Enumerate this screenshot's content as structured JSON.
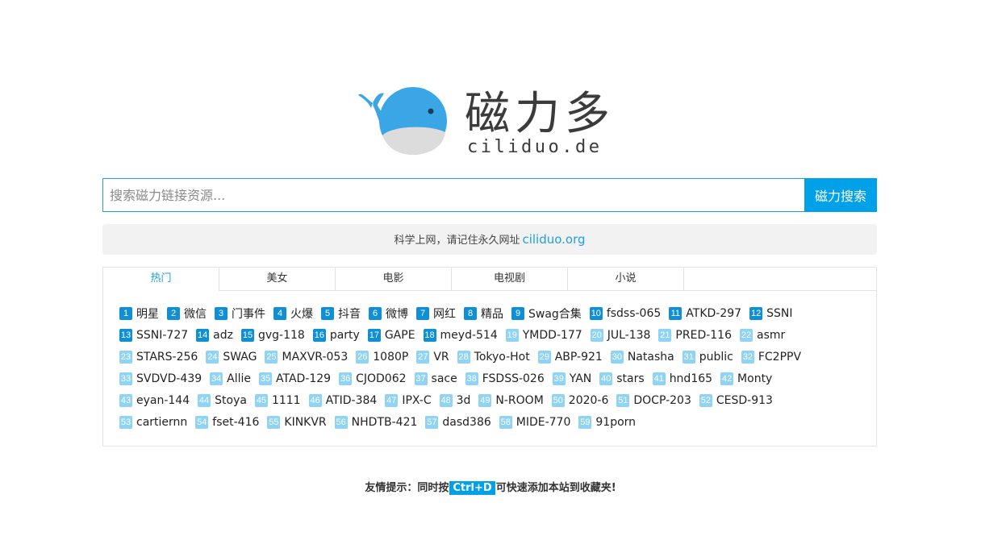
{
  "logo": {
    "title": "磁力多",
    "domain": "ciliduo.de",
    "icon": "whale-icon",
    "brand_color": "#3aa6e6"
  },
  "search": {
    "placeholder": "搜索磁力链接资源...",
    "value": "",
    "button_label": "磁力搜索"
  },
  "notice": {
    "text": "科学上网，请记住永久网址",
    "link_text": "ciliduo.org"
  },
  "tabs": [
    {
      "label": "热门",
      "active": true
    },
    {
      "label": "美女",
      "active": false
    },
    {
      "label": "电影",
      "active": false
    },
    {
      "label": "电视剧",
      "active": false
    },
    {
      "label": "小说",
      "active": false
    }
  ],
  "tags": [
    {
      "num": "1",
      "label": "明星"
    },
    {
      "num": "2",
      "label": "微信"
    },
    {
      "num": "3",
      "label": "门事件"
    },
    {
      "num": "4",
      "label": "火爆"
    },
    {
      "num": "5",
      "label": "抖音"
    },
    {
      "num": "6",
      "label": "微博"
    },
    {
      "num": "7",
      "label": "网红"
    },
    {
      "num": "8",
      "label": "精品"
    },
    {
      "num": "9",
      "label": "Swag合集"
    },
    {
      "num": "10",
      "label": "fsdss-065"
    },
    {
      "num": "11",
      "label": "ATKD-297"
    },
    {
      "num": "12",
      "label": "SSNI"
    },
    {
      "num": "13",
      "label": "SSNI-727"
    },
    {
      "num": "14",
      "label": "adz"
    },
    {
      "num": "15",
      "label": "gvg-118"
    },
    {
      "num": "16",
      "label": "party"
    },
    {
      "num": "17",
      "label": "GAPE"
    },
    {
      "num": "18",
      "label": "meyd-514"
    },
    {
      "num": "19",
      "label": "YMDD-177"
    },
    {
      "num": "20",
      "label": "JUL-138"
    },
    {
      "num": "21",
      "label": "PRED-116"
    },
    {
      "num": "22",
      "label": "asmr"
    },
    {
      "num": "23",
      "label": "STARS-256"
    },
    {
      "num": "24",
      "label": "SWAG"
    },
    {
      "num": "25",
      "label": "MAXVR-053"
    },
    {
      "num": "26",
      "label": "1080P"
    },
    {
      "num": "27",
      "label": "VR"
    },
    {
      "num": "28",
      "label": "Tokyo-Hot"
    },
    {
      "num": "29",
      "label": "ABP-921"
    },
    {
      "num": "30",
      "label": "Natasha"
    },
    {
      "num": "31",
      "label": "public"
    },
    {
      "num": "32",
      "label": "FC2PPV"
    },
    {
      "num": "33",
      "label": "SVDVD-439"
    },
    {
      "num": "34",
      "label": "Allie"
    },
    {
      "num": "35",
      "label": "ATAD-129"
    },
    {
      "num": "36",
      "label": "CJOD062"
    },
    {
      "num": "37",
      "label": "sace"
    },
    {
      "num": "38",
      "label": "FSDSS-026"
    },
    {
      "num": "39",
      "label": "YAN"
    },
    {
      "num": "40",
      "label": "stars"
    },
    {
      "num": "41",
      "label": "hnd165"
    },
    {
      "num": "42",
      "label": "Monty"
    },
    {
      "num": "43",
      "label": "eyan-144"
    },
    {
      "num": "44",
      "label": "Stoya"
    },
    {
      "num": "45",
      "label": "1111"
    },
    {
      "num": "46",
      "label": "ATID-384"
    },
    {
      "num": "47",
      "label": "IPX-C"
    },
    {
      "num": "48",
      "label": "3d"
    },
    {
      "num": "49",
      "label": "N-ROOM"
    },
    {
      "num": "50",
      "label": "2020-6"
    },
    {
      "num": "51",
      "label": "DOCP-203"
    },
    {
      "num": "52",
      "label": "CESD-913"
    },
    {
      "num": "53",
      "label": "cartiernn"
    },
    {
      "num": "54",
      "label": "fset-416"
    },
    {
      "num": "55",
      "label": "KINKVR"
    },
    {
      "num": "56",
      "label": "NHDTB-421"
    },
    {
      "num": "57",
      "label": "dasd386"
    },
    {
      "num": "58",
      "label": "MIDE-770"
    },
    {
      "num": "59",
      "label": "91porn"
    }
  ],
  "colors": {
    "accent": "#00a1e9",
    "badge_dark": "#0e8fd6",
    "badge_light": "#8fd3f5"
  },
  "footer": {
    "tip_prefix": "友情提示：同时按",
    "shortcut": "Ctrl+D",
    "tip_suffix": "可快速添加本站到收藏夹!"
  }
}
